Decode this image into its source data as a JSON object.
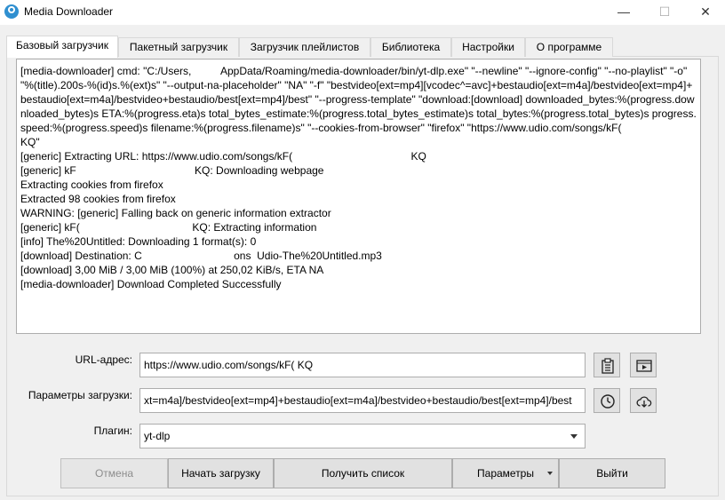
{
  "window": {
    "title": "Media Downloader",
    "minimize": "—",
    "maximize": "☐",
    "close": "✕"
  },
  "tabs": [
    {
      "label": "Базовый загрузчик",
      "active": true
    },
    {
      "label": "Пакетный загрузчик"
    },
    {
      "label": "Загрузчик плейлистов"
    },
    {
      "label": "Библиотека"
    },
    {
      "label": "Настройки"
    },
    {
      "label": "О программе"
    }
  ],
  "log": [
    "[media-downloader] cmd: \"C:/Users,          AppData/Roaming/media-downloader/bin/yt-dlp.exe\" \"--newline\" \"--ignore-config\" \"--no-playlist\" \"-o\" \"%(title).200s-%(id)s.%(ext)s\" \"--output-na-placeholder\" \"NA\" \"-f\" \"bestvideo[ext=mp4][vcodec^=avc]+bestaudio[ext=m4a]/bestvideo[ext=mp4]+bestaudio[ext=m4a]/bestvideo+bestaudio/best[ext=mp4]/best\" \"--progress-template\" \"download:[download] downloaded_bytes:%(progress.downloaded_bytes)s ETA:%(progress.eta)s total_bytes_estimate:%(progress.total_bytes_estimate)s total_bytes:%(progress.total_bytes)s progress.speed:%(progress.speed)s filename:%(progress.filename)s\" \"--cookies-from-browser\" \"firefox\" \"https://www.udio.com/songs/kF(                                   KQ\"",
    "[generic] Extracting URL: https://www.udio.com/songs/kF(                                        KQ",
    "[generic] kF                                        KQ: Downloading webpage",
    "Extracting cookies from firefox",
    "Extracted 98 cookies from firefox",
    "WARNING: [generic] Falling back on generic information extractor",
    "[generic] kF(                                      KQ: Extracting information",
    "[info] The%20Untitled: Downloading 1 format(s): 0",
    "[download] Destination: C                               ons  Udio-The%20Untitled.mp3",
    "[download] 3,00 MiB / 3,00 MiB (100%) at 250,02 KiB/s, ETA NA",
    "[media-downloader] Download Completed Successfully"
  ],
  "form": {
    "url_label": "URL-адрес:",
    "url_value": "https://www.udio.com/songs/kF(                                   KQ",
    "options_label": "Параметры загрузки:",
    "options_value": "xt=m4a]/bestvideo[ext=mp4]+bestaudio[ext=m4a]/bestvideo+bestaudio/best[ext=mp4]/best",
    "plugin_label": "Плагин:",
    "plugin_value": "yt-dlp"
  },
  "icons": {
    "clipboard": "clipboard-icon",
    "video": "video-icon",
    "history": "history-icon",
    "cloud": "cloud-download-icon"
  },
  "buttons": {
    "cancel": "Отмена",
    "start": "Начать загрузку",
    "get_list": "Получить список",
    "options": "Параметры",
    "exit": "Выйти"
  }
}
